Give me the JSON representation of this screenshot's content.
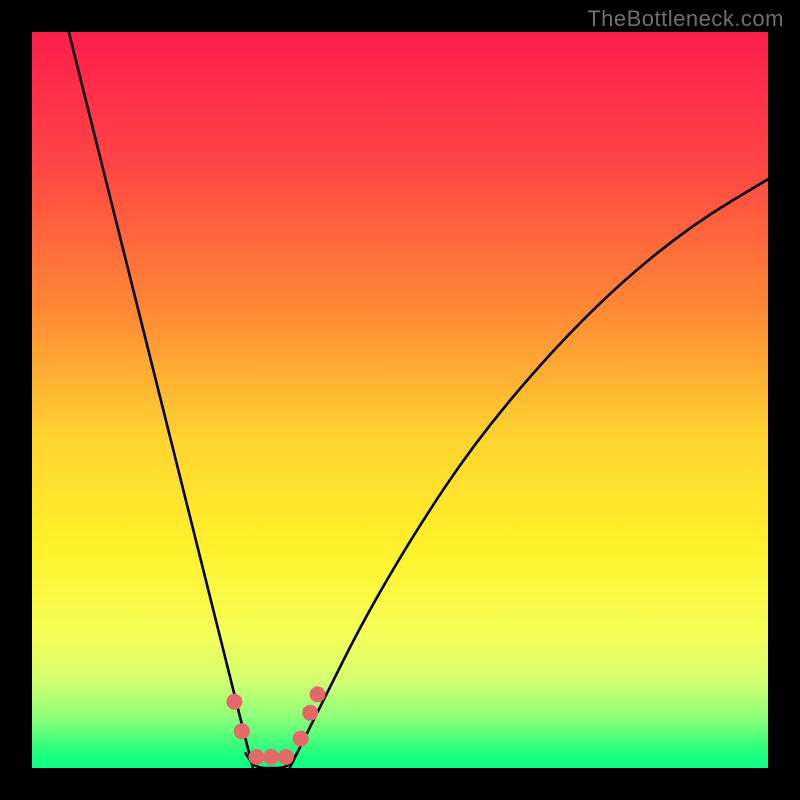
{
  "watermark": "TheBottleneck.com",
  "chart_data": {
    "type": "line",
    "title": "",
    "xlabel": "",
    "ylabel": "",
    "xlim": [
      0,
      100
    ],
    "ylim": [
      0,
      100
    ],
    "grid": false,
    "legend": false,
    "series": [
      {
        "name": "left-curve",
        "x": [
          5,
          8,
          12,
          16,
          20,
          24,
          26,
          28,
          29,
          30
        ],
        "y": [
          100,
          88,
          72,
          56,
          40,
          24,
          16,
          8,
          4,
          0
        ]
      },
      {
        "name": "right-curve",
        "x": [
          35,
          37,
          40,
          45,
          52,
          60,
          70,
          80,
          90,
          100
        ],
        "y": [
          0,
          4,
          10,
          20,
          32,
          44,
          56,
          66,
          74,
          80
        ]
      },
      {
        "name": "dip-floor",
        "x": [
          29,
          30,
          31,
          32.5,
          34,
          35,
          36
        ],
        "y": [
          2,
          0.5,
          0,
          0,
          0,
          0.5,
          2
        ]
      }
    ],
    "markers": [
      {
        "x": 27.5,
        "y": 9,
        "r": 8
      },
      {
        "x": 28.5,
        "y": 5,
        "r": 8
      },
      {
        "x": 30.5,
        "y": 1.5,
        "r": 8
      },
      {
        "x": 32.5,
        "y": 1.5,
        "r": 8
      },
      {
        "x": 34.5,
        "y": 1.5,
        "r": 8
      },
      {
        "x": 36.5,
        "y": 4,
        "r": 8
      },
      {
        "x": 37.8,
        "y": 7.5,
        "r": 8
      },
      {
        "x": 38.8,
        "y": 10,
        "r": 8
      }
    ],
    "gradient_stops": [
      {
        "offset": 0,
        "color": "#ff1e4c"
      },
      {
        "offset": 0.18,
        "color": "#ff4545"
      },
      {
        "offset": 0.38,
        "color": "#ff8a35"
      },
      {
        "offset": 0.55,
        "color": "#ffd330"
      },
      {
        "offset": 0.7,
        "color": "#fff22a"
      },
      {
        "offset": 0.82,
        "color": "#f4ff58"
      },
      {
        "offset": 0.88,
        "color": "#d4ff70"
      },
      {
        "offset": 0.93,
        "color": "#8fff7a"
      },
      {
        "offset": 0.975,
        "color": "#2bff7c"
      },
      {
        "offset": 1.0,
        "color": "#0aff86"
      }
    ],
    "marker_color": "#e46a6a",
    "line_color": "#000000",
    "line_width": 2.6
  }
}
